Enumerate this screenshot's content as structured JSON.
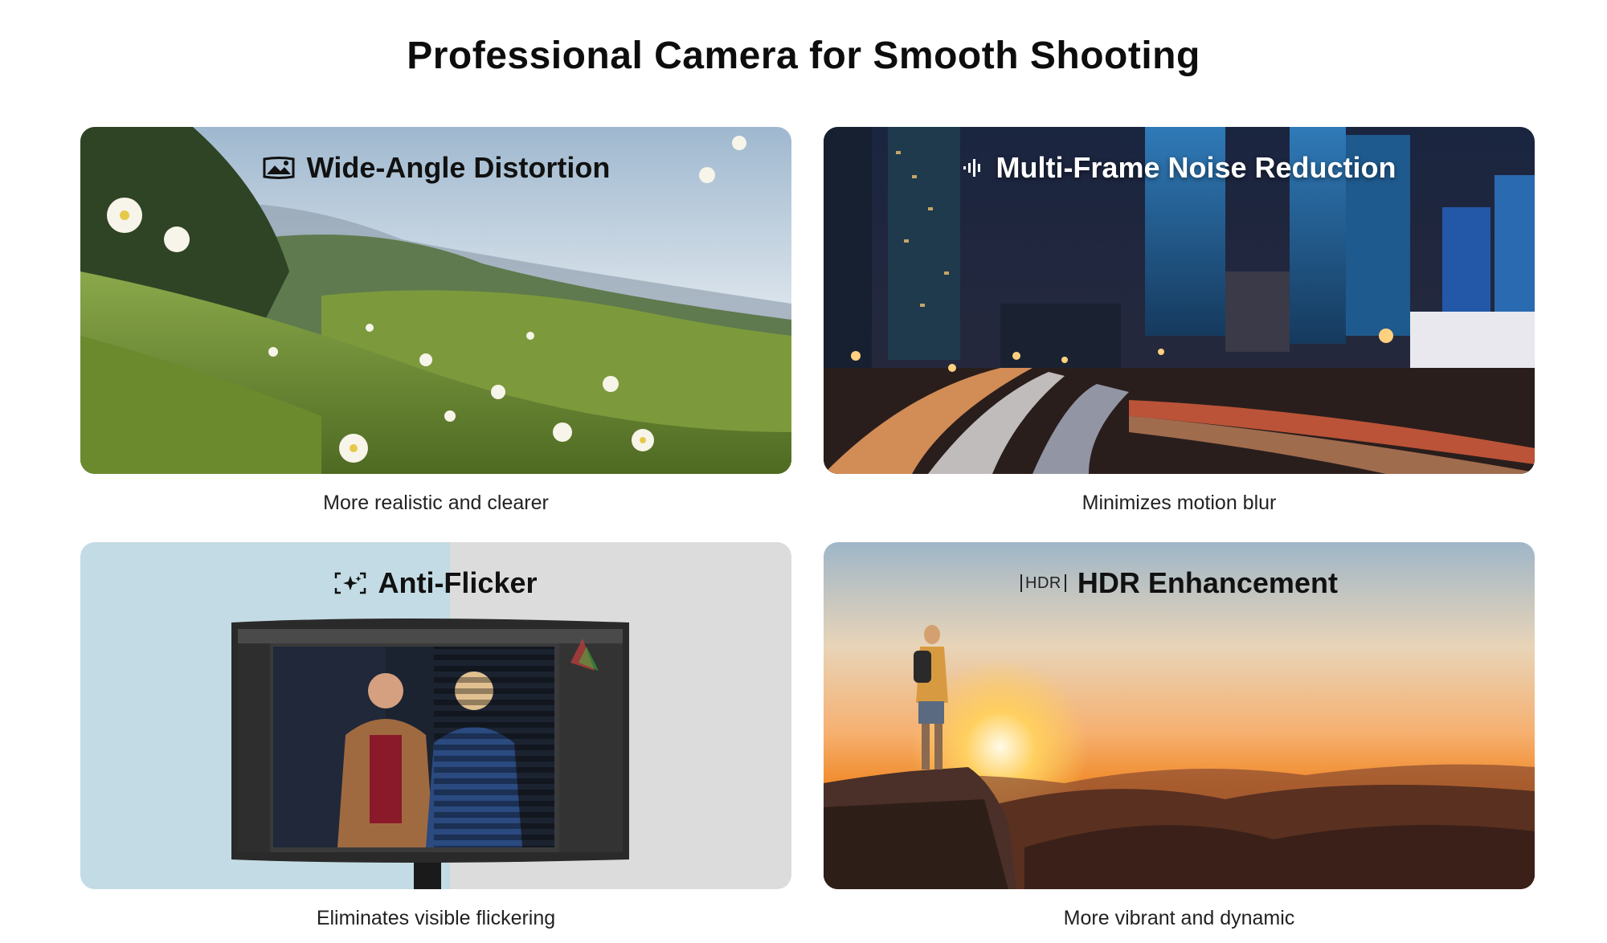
{
  "page": {
    "title": "Professional Camera for Smooth Shooting"
  },
  "features": [
    {
      "heading": "Wide-Angle Distortion",
      "caption": "More realistic and clearer",
      "icon": "landscape-photo-icon"
    },
    {
      "heading": "Multi-Frame Noise Reduction",
      "caption": "Minimizes motion blur",
      "icon": "sound-wave-icon"
    },
    {
      "heading": "Anti-Flicker",
      "caption": "Eliminates visible flickering",
      "icon": "sparkle-frame-icon"
    },
    {
      "heading": "HDR Enhancement",
      "caption": "More vibrant and dynamic",
      "icon": "hdr-icon",
      "icon_text": "HDR"
    }
  ],
  "colors": {
    "title": "#0d0d0d",
    "caption": "#222222",
    "sky_blue_panel": "#c3dbe4",
    "grey_panel": "#dcdcdc",
    "sunset_orange": "#f08a2a"
  }
}
